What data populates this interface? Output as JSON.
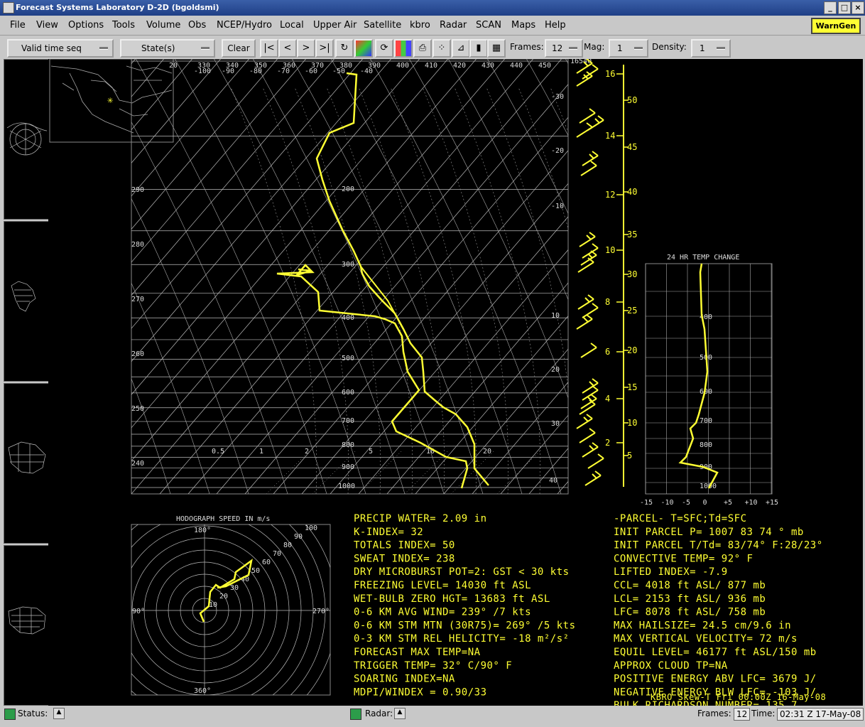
{
  "window": {
    "title": "Forecast Systems Laboratory D-2D (bgoldsmi)",
    "minimize": "_",
    "maximize": "□",
    "close": "×"
  },
  "menus": [
    "File",
    "View",
    "Options",
    "Tools",
    "Volume",
    "Obs",
    "NCEP/Hydro",
    "Local",
    "Upper Air",
    "Satellite",
    "kbro",
    "Radar",
    "SCAN",
    "Maps",
    "Help"
  ],
  "warngen_label": "WarnGen",
  "toolbar": {
    "valid_time": "Valid time seq",
    "states": "State(s)",
    "clear": "Clear",
    "frames_label": "Frames:",
    "frames_value": "12",
    "mag_label": "Mag:",
    "mag_value": "1",
    "density_label": "Density:",
    "density_value": "1",
    "icons": [
      "first-frame-icon",
      "prev-frame-icon",
      "next-frame-icon",
      "last-frame-icon",
      "loop-icon",
      "color-table-icon",
      "refresh-icon",
      "image-combine-icon",
      "print-icon",
      "points-icon",
      "baselines-icon",
      "panel-single-icon",
      "panel-four-icon"
    ]
  },
  "skewt": {
    "temp_labels": [
      "20",
      "330",
      "340",
      "350",
      "360",
      "370",
      "380",
      "390",
      "400",
      "410",
      "420",
      "430",
      "440",
      "450"
    ],
    "cel_labels": [
      "-100",
      "-90",
      "-80",
      "-70",
      "-60",
      "-50",
      "-40"
    ],
    "theta_labels": [
      "290",
      "280",
      "270",
      "260",
      "250",
      "240"
    ],
    "pressure_labels": [
      "200",
      "300",
      "400",
      "500",
      "600",
      "700",
      "800",
      "900",
      "1000"
    ],
    "mixing_labels": [
      "0.5",
      "1",
      "2",
      "5",
      "10",
      "20"
    ],
    "isotherm_labels": [
      "-30",
      "-20",
      "-10",
      "10",
      "20",
      "30",
      "40"
    ],
    "top_height": "16540",
    "km_labels": [
      "16",
      "14",
      "12",
      "10",
      "8",
      "6",
      "4",
      "2"
    ],
    "kft_labels": [
      "50",
      "45",
      "40",
      "35",
      "30",
      "25",
      "20",
      "15",
      "10",
      "5"
    ]
  },
  "temp_change": {
    "title": "24 HR TEMP CHANGE",
    "x_labels": [
      "-15",
      "-10",
      "-5",
      "0",
      "+5",
      "+10",
      "+15"
    ],
    "p_labels": [
      "400",
      "500",
      "600",
      "700",
      "800",
      "900",
      "1000"
    ]
  },
  "hodograph": {
    "title": "HODOGRAPH SPEED IN m/s",
    "dir_labels": [
      "180°",
      "90°",
      "270°",
      "360°"
    ],
    "speed_labels": [
      "10",
      "20",
      "30",
      "40",
      "50",
      "60",
      "70",
      "80",
      "90",
      "100"
    ]
  },
  "indices_left": [
    "PRECIP  WATER=  2.09  in",
    "K-INDEX=  32",
    "TOTALS  INDEX=  50",
    "SWEAT  INDEX=  238",
    "DRY  MICROBURST  POT=2:  GST  <  30  kts",
    "FREEZING  LEVEL=  14030  ft  ASL",
    "WET-BULB  ZERO  HGT=  13683  ft  ASL",
    "0-6  KM  AVG  WIND=  239° /7  kts",
    "0-6  KM  STM  MTN  (30R75)=  269° /5  kts",
    "0-3  KM  STM  REL  HELICITY=  -18  m²/s²",
    "FORECAST  MAX  TEMP=NA",
    "TRIGGER  TEMP=  32° C/90° F",
    "SOARING  INDEX=NA",
    "MDPI/WINDEX  =  0.90/33"
  ],
  "indices_right": [
    "-PARCEL-  T=SFC;Td=SFC",
    "INIT  PARCEL  P=  1007  83  74  °  mb",
    "INIT  PARCEL  T/Td=  83/74° F:28/23°",
    "CONVECTIVE  TEMP=  92° F",
    "LIFTED  INDEX=  -7.9",
    "CCL=  4018  ft  ASL/  877  mb",
    "LCL=  2153  ft  ASL/  936  mb",
    "LFC=  8078  ft  ASL/  758  mb",
    "MAX  HAILSIZE=  24.5  cm/9.6  in",
    "MAX  VERTICAL  VELOCITY=  72  m/s",
    "EQUIL  LEVEL=  46177  ft  ASL/150  mb",
    "APPROX  CLOUD  TP=NA",
    "POSITIVE  ENERGY  ABV  LFC=  3679  J/",
    "NEGATIVE  ENERGY  BLW  LFC=  -103  J/",
    "BULK  RICHARDSON  NUMBER=  135.7"
  ],
  "footer_overlay": "KBRO  Skew-T  Fri  00:00Z  16-May-08",
  "status": {
    "status_label": "Status:",
    "radar_label": "Radar:",
    "frames_label": "Frames:",
    "frames_value": "12",
    "time_label": "Time:",
    "time_value": "02:31 Z 17-May-08"
  },
  "colors": {
    "sounding": "#ffff33",
    "grid": "#ffffff",
    "background": "#000000",
    "warngen": "#ffff33"
  }
}
